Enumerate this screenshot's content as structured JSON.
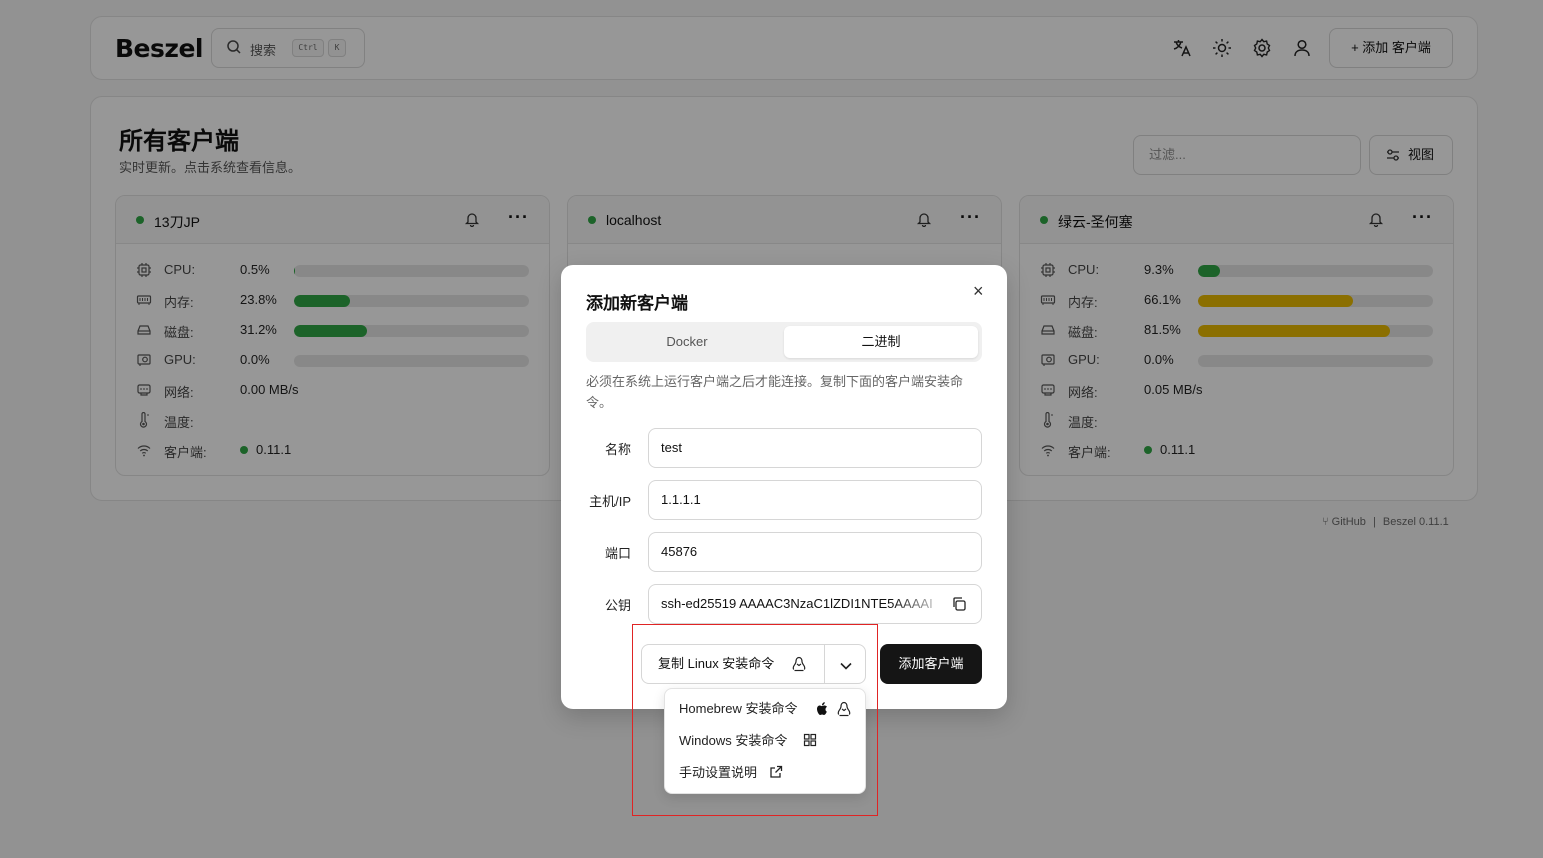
{
  "app": {
    "logo": "Beszel"
  },
  "search": {
    "placeholder": "搜索",
    "kbd1": "Ctrl",
    "kbd2": "K"
  },
  "header": {
    "add_label": "添加 客户端",
    "icons": [
      "translate-icon",
      "sun-icon",
      "gear-icon",
      "user-icon"
    ]
  },
  "main": {
    "title": "所有客户端",
    "subtitle": "实时更新。点击系统查看信息。",
    "filter_placeholder": "过滤...",
    "view_label": "视图"
  },
  "labels": {
    "cpu": "CPU:",
    "mem": "内存:",
    "disk": "磁盘:",
    "gpu": "GPU:",
    "net": "网络:",
    "temp": "温度:",
    "agent": "客户端:"
  },
  "cards": [
    {
      "name": "13刀JP",
      "cpu": "0.5%",
      "cpu_pct": 0.5,
      "mem": "23.8%",
      "mem_pct": 23.8,
      "disk": "31.2%",
      "disk_pct": 31.2,
      "gpu": "0.0%",
      "gpu_pct": 0,
      "net": "0.00 MB/s",
      "temp": "",
      "agent": "0.11.1"
    },
    {
      "name": "localhost"
    },
    {
      "name": "绿云-圣何塞",
      "cpu": "9.3%",
      "cpu_pct": 9.3,
      "mem": "66.1%",
      "mem_pct": 66.1,
      "disk": "81.5%",
      "disk_pct": 81.5,
      "gpu": "0.0%",
      "gpu_pct": 0,
      "net": "0.05 MB/s",
      "temp": "",
      "agent": "0.11.1"
    }
  ],
  "colors": {
    "ok": "#2ea043",
    "warn": "#e0b400",
    "track": "#dcdcdc"
  },
  "footer": {
    "github": "GitHub",
    "sep": "|",
    "version": "Beszel 0.11.1"
  },
  "modal": {
    "title": "添加新客户端",
    "close": "×",
    "tabs": [
      "Docker",
      "二进制"
    ],
    "active_tab": "二进制",
    "description": "必须在系统上运行客户端之后才能连接。复制下面的客户端安装命令。",
    "fields": {
      "name_label": "名称",
      "name_value": "test",
      "host_label": "主机/IP",
      "host_value": "1.1.1.1",
      "port_label": "端口",
      "port_value": "45876",
      "key_label": "公钥",
      "key_value": "ssh-ed25519 AAAAC3NzaC1lZDI1NTE5AAAAI"
    },
    "copy_label": "复制 Linux 安装命令",
    "submit_label": "添加客户端"
  },
  "dropdown": {
    "items": [
      "Homebrew 安装命令",
      "Windows 安装命令",
      "手动设置说明"
    ]
  }
}
